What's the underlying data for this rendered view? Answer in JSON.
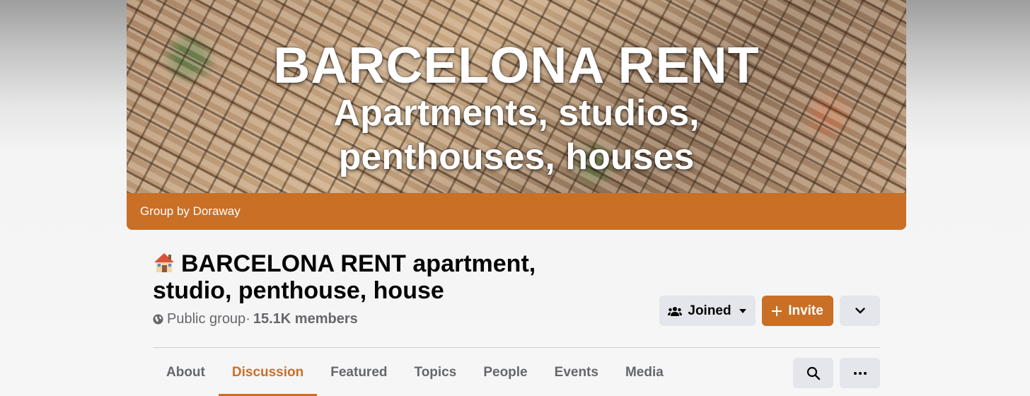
{
  "cover": {
    "title_line1": "BARCELONA RENT",
    "title_line2": "Apartments, studios,",
    "title_line3": "penthouses, houses",
    "group_by": "Group by Doraway"
  },
  "group": {
    "title_emoji": "house-icon",
    "title": "BARCELONA RENT apartment, studio, penthouse, house",
    "privacy": "Public group",
    "separator": " · ",
    "members": "15.1K members"
  },
  "actions": {
    "joined_label": "Joined",
    "invite_label": "Invite"
  },
  "tabs": [
    {
      "label": "About",
      "active": false
    },
    {
      "label": "Discussion",
      "active": true
    },
    {
      "label": "Featured",
      "active": false
    },
    {
      "label": "Topics",
      "active": false
    },
    {
      "label": "People",
      "active": false
    },
    {
      "label": "Events",
      "active": false
    },
    {
      "label": "Media",
      "active": false
    }
  ],
  "colors": {
    "accent": "#c96f26",
    "button_gray": "#e4e6eb",
    "text_secondary": "#65676b"
  }
}
